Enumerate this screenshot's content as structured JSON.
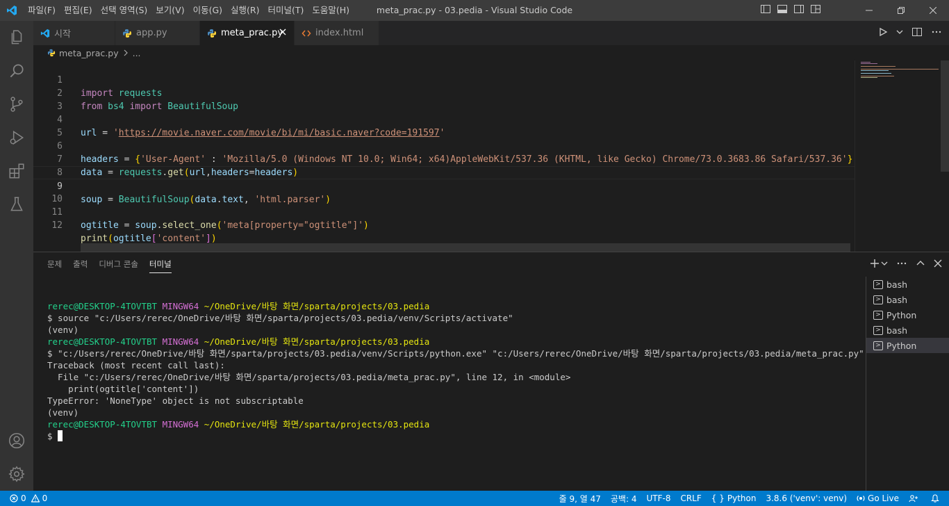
{
  "titlebar": {
    "menu": [
      "파일(F)",
      "편집(E)",
      "선택 영역(S)",
      "보기(V)",
      "이동(G)",
      "실행(R)",
      "터미널(T)",
      "도움말(H)"
    ],
    "title": "meta_prac.py - 03.pedia - Visual Studio Code"
  },
  "tabs": [
    {
      "label": "시작",
      "icon": "vscode-icon"
    },
    {
      "label": "app.py",
      "icon": "python-icon"
    },
    {
      "label": "meta_prac.py",
      "icon": "python-icon",
      "active": true
    },
    {
      "label": "index.html",
      "icon": "html-icon"
    }
  ],
  "breadcrumb": {
    "file": "meta_prac.py",
    "more": "..."
  },
  "editor": {
    "line_numbers": [
      "1",
      "2",
      "3",
      "4",
      "5",
      "6",
      "7",
      "8",
      "9",
      "10",
      "11",
      "12"
    ],
    "current_line": "9",
    "code": {
      "l1": {
        "k": "import",
        "m": "requests"
      },
      "l2": {
        "k1": "from",
        "m1": "bs4",
        "k2": "import",
        "m2": "BeautifulSoup"
      },
      "l4": {
        "v": "url",
        "eq": " = ",
        "q1": "'",
        "u": "https://movie.naver.com/movie/bi/mi/basic.naver?code=191597",
        "q2": "'"
      },
      "l6": {
        "v": "headers",
        "eq": " = ",
        "b1": "{",
        "s1": "'User-Agent'",
        "c": " : ",
        "s2": "'Mozilla/5.0 (Windows NT 10.0; Win64; x64)AppleWebKit/537.36 (KHTML, like Gecko) Chrome/73.0.3683.86 Safari/537.36'",
        "b2": "}"
      },
      "l7": {
        "v": "data",
        "eq": " = ",
        "m": "requests",
        "dot": ".",
        "f": "get",
        "p1": "(",
        "a1": "url",
        "comma": ",",
        "a2": "headers",
        "eq2": "=",
        "a3": "headers",
        "p2": ")"
      },
      "l9": {
        "v": "soup",
        "eq": " = ",
        "f": "BeautifulSoup",
        "p1": "(",
        "a1": "data",
        "dot": ".",
        "a2": "text",
        "comma": ", ",
        "s": "'html.parser'",
        "p2": ")"
      },
      "l11": {
        "v": "ogtitle",
        "eq": " = ",
        "a1": "soup",
        "dot": ".",
        "f": "select_one",
        "p1": "(",
        "s": "'meta[property=\"ogtitle\"]'",
        "p2": ")"
      },
      "l12": {
        "f": "print",
        "p1": "(",
        "a1": "ogtitle",
        "b1": "[",
        "s": "'content'",
        "b2": "]",
        "p2": ")"
      }
    }
  },
  "panel": {
    "tabs": [
      "문제",
      "출력",
      "디버그 콘솔",
      "터미널"
    ],
    "active_tab": "터미널",
    "terminal": {
      "user": "rerec@DESKTOP-4TOVTBT",
      "mingw": "MINGW64",
      "path": "~/OneDrive/바탕 화면/sparta/projects/03.pedia",
      "cmd1": "$ source \"c:/Users/rerec/OneDrive/바탕 화면/sparta/projects/03.pedia/venv/Scripts/activate\"",
      "venv": "(venv)",
      "cmd2": "$ \"c:/Users/rerec/OneDrive/바탕 화면/sparta/projects/03.pedia/venv/Scripts/python.exe\" \"c:/Users/rerec/OneDrive/바탕 화면/sparta/projects/03.pedia/meta_prac.py\"",
      "tb1": "Traceback (most recent call last):",
      "tb2": "  File \"c:/Users/rerec/OneDrive/바탕 화면/sparta/projects/03.pedia/meta_prac.py\", line 12, in <module>",
      "tb3": "    print(ogtitle['content'])",
      "tb4": "TypeError: 'NoneType' object is not subscriptable",
      "prompt": "$ "
    },
    "terminal_list": [
      "bash",
      "bash",
      "Python",
      "bash",
      "Python"
    ],
    "active_terminal_index": 4
  },
  "statusbar": {
    "errors": "0",
    "warnings": "0",
    "position": "줄 9, 열 47",
    "spaces": "공백: 4",
    "encoding": "UTF-8",
    "eol": "CRLF",
    "language": "Python",
    "interpreter": "3.8.6 ('venv': venv)",
    "golive": "Go Live"
  },
  "colors": {
    "accent": "#007acc",
    "titlebar": "#3c3c3c",
    "activitybar": "#333333",
    "editor_bg": "#1e1e1e"
  }
}
